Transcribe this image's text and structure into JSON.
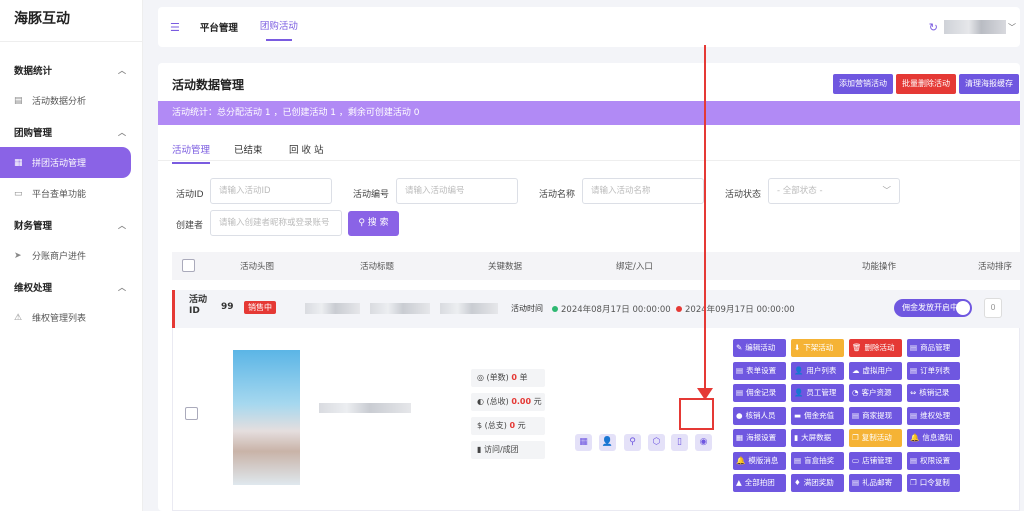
{
  "app": {
    "title": "海豚互动"
  },
  "sidebar": {
    "groups": [
      {
        "label": "数据统计",
        "items": [
          {
            "label": "活动数据分析",
            "icon": "doc-icon"
          }
        ]
      },
      {
        "label": "团购管理",
        "items": [
          {
            "label": "拼团活动管理",
            "icon": "grid-doc-icon",
            "active": true
          },
          {
            "label": "平台查单功能",
            "icon": "folder-icon"
          }
        ]
      },
      {
        "label": "财务管理",
        "items": [
          {
            "label": "分账商户进件",
            "icon": "send-icon"
          }
        ]
      },
      {
        "label": "维权处理",
        "items": [
          {
            "label": "维权管理列表",
            "icon": "warning-icon"
          }
        ]
      }
    ]
  },
  "topbar": {
    "nav1": "平台管理",
    "nav2": "团购活动"
  },
  "page": {
    "title": "活动数据管理",
    "buttons": [
      {
        "label": "添加营销活动",
        "color": "#6f57e0"
      },
      {
        "label": "批量删除活动",
        "color": "#e53935"
      },
      {
        "label": "清理海报缓存",
        "color": "#6f57e0"
      }
    ],
    "banner": "活动统计：总分配活动 1 ，已创建活动 1 ，剩余可创建活动 0"
  },
  "tabs": [
    "活动管理",
    "已结束",
    "回 收 站"
  ],
  "filters": {
    "id": {
      "label": "活动ID",
      "placeholder": "请输入活动ID"
    },
    "code": {
      "label": "活动编号",
      "placeholder": "请输入活动编号"
    },
    "name": {
      "label": "活动名称",
      "placeholder": "请输入活动名称"
    },
    "status": {
      "label": "活动状态",
      "placeholder": "- 全部状态 -"
    },
    "creator": {
      "label": "创建者",
      "placeholder": "请输入创建者昵称或登录账号"
    },
    "search": "搜 索"
  },
  "table": {
    "headers": [
      "活动头图",
      "活动标题",
      "关键数据",
      "绑定/入口",
      "功能操作",
      "活动排序"
    ]
  },
  "row": {
    "id_label": "活动ID",
    "id": "99",
    "status": "销售中",
    "time_label": "活动时间",
    "start": "2024年08月17日 00:00:00",
    "end": "2024年09月17日 00:00:00",
    "toggle": "佣金发放开启中",
    "sort": "0",
    "stats": [
      {
        "label": "(单数)",
        "value": "0",
        "unit": "单"
      },
      {
        "label": "(总收)",
        "value": "0.00",
        "unit": "元"
      },
      {
        "label": "(总支)",
        "value": "0",
        "unit": "元"
      },
      {
        "label": "访问/成团",
        "value": "",
        "unit": ""
      }
    ],
    "actions": [
      {
        "label": "编辑活动",
        "color": "#6f57e0",
        "icon": "✎"
      },
      {
        "label": "下架活动",
        "color": "#f5b335",
        "icon": "⬇"
      },
      {
        "label": "删除活动",
        "color": "#e53935",
        "icon": "🗑"
      },
      {
        "label": "商品管理",
        "color": "#6f57e0",
        "icon": "▤"
      },
      {
        "label": "表单设置",
        "color": "#6f57e0",
        "icon": "▤"
      },
      {
        "label": "用户列表",
        "color": "#6f57e0",
        "icon": "👤"
      },
      {
        "label": "虚拟用户",
        "color": "#6f57e0",
        "icon": "☁"
      },
      {
        "label": "订单列表",
        "color": "#6f57e0",
        "icon": "▤"
      },
      {
        "label": "佣金记录",
        "color": "#6f57e0",
        "icon": "▤"
      },
      {
        "label": "员工管理",
        "color": "#6f57e0",
        "icon": "👤"
      },
      {
        "label": "客户资源",
        "color": "#6f57e0",
        "icon": "◔"
      },
      {
        "label": "核销记录",
        "color": "#6f57e0",
        "icon": "⇔"
      },
      {
        "label": "核销人员",
        "color": "#6f57e0",
        "icon": "●"
      },
      {
        "label": "佣金充值",
        "color": "#6f57e0",
        "icon": "▬"
      },
      {
        "label": "商家提现",
        "color": "#6f57e0",
        "icon": "▤"
      },
      {
        "label": "维权处理",
        "color": "#6f57e0",
        "icon": "▤"
      },
      {
        "label": "海报设置",
        "color": "#6f57e0",
        "icon": "▦"
      },
      {
        "label": "大屏数据",
        "color": "#6f57e0",
        "icon": "▮"
      },
      {
        "label": "复制活动",
        "color": "#f5b335",
        "icon": "❐"
      },
      {
        "label": "信息通知",
        "color": "#6f57e0",
        "icon": "🔔"
      },
      {
        "label": "模版消息",
        "color": "#6f57e0",
        "icon": "🔔"
      },
      {
        "label": "盲盒抽奖",
        "color": "#6f57e0",
        "icon": "▤"
      },
      {
        "label": "店铺管理",
        "color": "#6f57e0",
        "icon": "▭"
      },
      {
        "label": "权限设置",
        "color": "#6f57e0",
        "icon": "▤"
      },
      {
        "label": "全部拍团",
        "color": "#6f57e0",
        "icon": "▲"
      },
      {
        "label": "满团奖励",
        "color": "#6f57e0",
        "icon": "♦"
      },
      {
        "label": "礼品邮寄",
        "color": "#6f57e0",
        "icon": "▤"
      },
      {
        "label": "口令复制",
        "color": "#6f57e0",
        "icon": "❐"
      }
    ]
  }
}
